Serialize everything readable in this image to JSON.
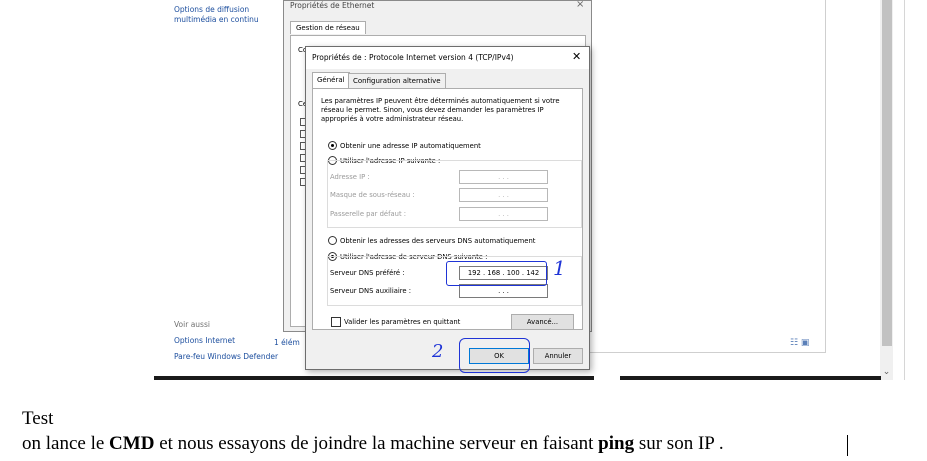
{
  "control_panel": {
    "links_top": [
      "Options de diffusion",
      "multimédia en continu"
    ],
    "see_also": "Voir aussi",
    "links_bottom": [
      "Options Internet",
      "Pare-feu Windows Defender"
    ],
    "status": "1 élém"
  },
  "ethernet_window": {
    "title": "Propriétés de Ethernet",
    "tab": "Gestion de réseau",
    "stub_labels": [
      "Co",
      "Ce",
      "D"
    ]
  },
  "ipv4_dialog": {
    "title": "Propriétés de : Protocole Internet version 4 (TCP/IPv4)",
    "close_icon": "close-icon",
    "tabs": [
      "Général",
      "Configuration alternative"
    ],
    "intro": "Les paramètres IP peuvent être déterminés automatiquement si votre réseau le permet. Sinon, vous devez demander les paramètres IP appropriés à votre administrateur réseau.",
    "ip_auto": "Obtenir une adresse IP automatiquement",
    "ip_manual": "Utiliser l'adresse IP suivante :",
    "ip_fields": [
      {
        "label": "Adresse IP :",
        "value": ".    .    ."
      },
      {
        "label": "Masque de sous-réseau :",
        "value": ".    .    ."
      },
      {
        "label": "Passerelle par défaut :",
        "value": ".    .    ."
      }
    ],
    "dns_auto": "Obtenir les adresses des serveurs DNS automatiquement",
    "dns_manual": "Utiliser l'adresse de serveur DNS suivante :",
    "dns_fields": [
      {
        "label": "Serveur DNS préféré :",
        "value": "192 . 168 . 100 . 142"
      },
      {
        "label": "Serveur DNS auxiliaire :",
        "value": ".    .    ."
      }
    ],
    "validate_label": "Valider les paramètres en quittant",
    "advanced_button": "Avancé...",
    "ok_button": "OK",
    "cancel_button": "Annuler"
  },
  "annotations": {
    "dns_number": "1",
    "ok_number": "2"
  },
  "document": {
    "title": "Test",
    "line_parts": [
      "on lance le ",
      "CMD",
      " et nous essayons de joindre la machine serveur en faisant ",
      "ping",
      " sur son IP ."
    ]
  },
  "colors": {
    "annotation": "#1f34d6",
    "link": "#1c4e9e"
  }
}
